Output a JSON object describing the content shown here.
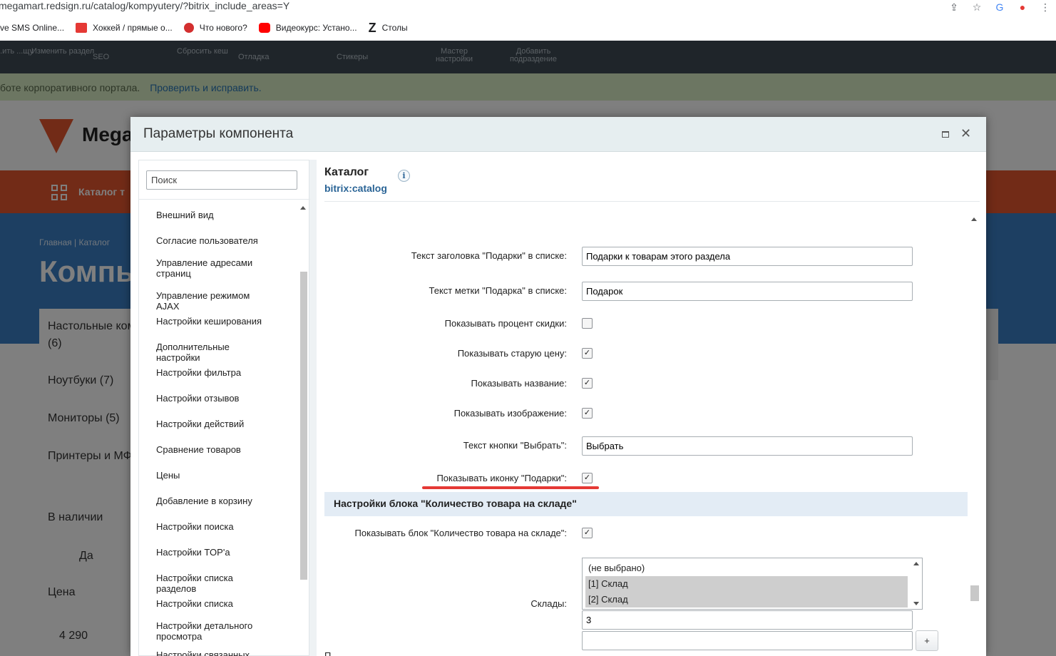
{
  "browser": {
    "url": "megamart.redsign.ru/catalog/kompyutery/?bitrix_include_areas=Y",
    "bookmarks": [
      {
        "label": "ve SMS Online...",
        "icon": "sms-icon",
        "color": "#ffffff"
      },
      {
        "label": "Хоккей / прямые о...",
        "icon": "live-icon",
        "color": "#e53935"
      },
      {
        "label": "Что нового?",
        "icon": "b-icon",
        "color": "#d32f2f"
      },
      {
        "label": "Видеокурс: Устано...",
        "icon": "youtube-icon",
        "color": "#ff0000"
      },
      {
        "label": "Столы",
        "icon": "z-icon",
        "color": "#000000"
      }
    ]
  },
  "background_page": {
    "adminbar": [
      "Изменить раздел",
      "SEO",
      "Сбросить кеш",
      "Отладка",
      "Стикеры",
      "Мастер настройки",
      "Добавить подраздение"
    ],
    "adminbar_left": "...ить ...щу",
    "notice_text": "боте корпоративного портала.",
    "notice_link": "Проверить и исправить.",
    "logo_text": "Mega",
    "menu_title": "Каталог т",
    "breadcrumbs": "Главная   |   Каталог",
    "heading": "Компь",
    "sidebar": [
      "Настольные ком",
      "(6)",
      "Ноутбуки (7)",
      "Мониторы (5)",
      "Принтеры и МФ",
      "В наличии",
      "Да",
      "Цена",
      "4 290"
    ]
  },
  "dialog": {
    "title": "Параметры компонента",
    "search_placeholder": "Поиск",
    "nav_items": [
      "Внешний вид",
      "Согласие пользователя",
      "Управление адресами страниц",
      "Управление режимом AJAX",
      "Настройки кеширования",
      "Дополнительные настройки",
      "Настройки фильтра",
      "Настройки отзывов",
      "Настройки действий",
      "Сравнение товаров",
      "Цены",
      "Добавление в корзину",
      "Настройки поиска",
      "Настройки TOP'a",
      "Настройки списка разделов",
      "Настройки списка",
      "Настройки детального просмотра",
      "Настройки связанных"
    ],
    "component_title": "Каталог",
    "component_code": "bitrix:catalog",
    "info_icon": "i",
    "fields": {
      "gift_header_label": "Текст заголовка \"Подарки\" в списке:",
      "gift_header_value": "Подарки к товарам этого раздела",
      "gift_mark_label": "Текст метки \"Подарка\" в списке:",
      "gift_mark_value": "Подарок",
      "show_discount_label": "Показывать процент скидки:",
      "show_discount_checked": false,
      "show_old_price_label": "Показывать старую цену:",
      "show_old_price_checked": true,
      "show_name_label": "Показывать название:",
      "show_name_checked": true,
      "show_image_label": "Показывать изображение:",
      "show_image_checked": true,
      "choose_button_label": "Текст кнопки \"Выбрать\":",
      "choose_button_value": "Выбрать",
      "show_gift_icon_label": "Показывать иконку \"Подарки\":",
      "show_gift_icon_checked": true
    },
    "section_header": "Настройки блока \"Количество товара на складе\"",
    "store_fields": {
      "show_store_block_label": "Показывать блок \"Количество товара на складе\":",
      "show_store_block_checked": true,
      "stores_label": "Склады:",
      "stores_options": [
        "(не выбрано)",
        "[1] Склад",
        "[2] Склад"
      ],
      "stores_selected": [
        1,
        2
      ],
      "stores_text_value": "3",
      "stores_extra_value": "",
      "add_button": "+"
    },
    "tail_text": "П..."
  }
}
